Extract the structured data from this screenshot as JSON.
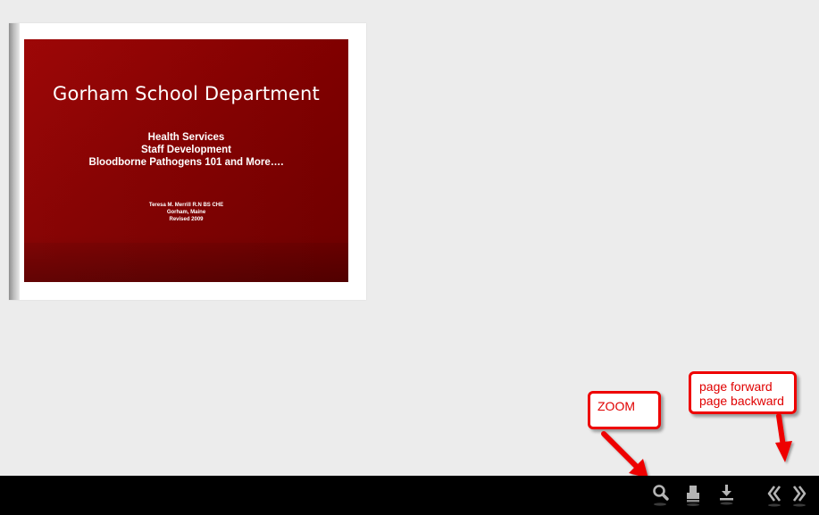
{
  "slide": {
    "title": "Gorham School Department",
    "subtitle_lines": [
      "Health Services",
      "Staff Development",
      "Bloodborne Pathogens 101 and More…."
    ],
    "author_lines": [
      "Teresa M. Merrill R.N  BS CHE",
      "Gorham, Maine",
      "Revised 2009"
    ]
  },
  "callouts": {
    "zoom": "ZOOM",
    "page_forward": "page forward",
    "page_backward": "page backward"
  },
  "toolbar": {
    "icons": [
      "zoom-icon",
      "print-icon",
      "download-icon",
      "page-backward-icon",
      "page-forward-icon"
    ]
  },
  "colors": {
    "slide_red": "#870000",
    "callout_red": "#ee0000",
    "toolbar_bg": "#000000",
    "icon_color": "#b0b0b0",
    "page_bg": "#ececec"
  }
}
